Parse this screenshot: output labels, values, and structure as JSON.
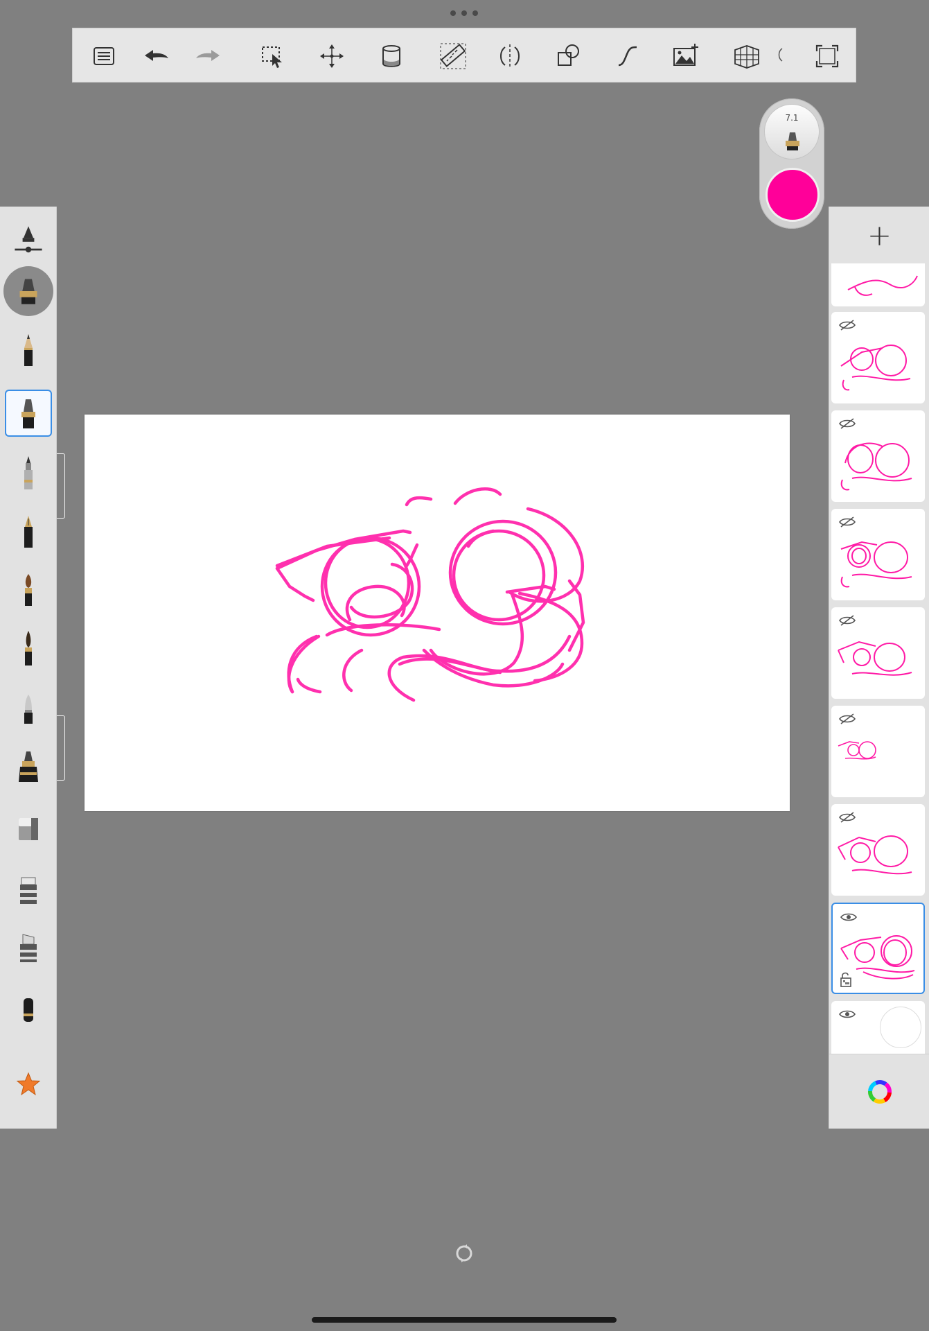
{
  "toolbar": {
    "items": [
      {
        "name": "layers-list-icon"
      },
      {
        "name": "undo-icon"
      },
      {
        "name": "redo-icon"
      },
      {
        "name": "selection-icon"
      },
      {
        "name": "transform-icon"
      },
      {
        "name": "fill-icon"
      },
      {
        "name": "ruler-icon"
      },
      {
        "name": "symmetry-icon"
      },
      {
        "name": "shapes-icon"
      },
      {
        "name": "curve-icon"
      },
      {
        "name": "import-image-icon"
      },
      {
        "name": "perspective-icon"
      },
      {
        "name": "fullscreen-icon"
      }
    ]
  },
  "brush_puck": {
    "size_label": "7.1",
    "color": "#ff0099"
  },
  "brush_library": {
    "tools": [
      "pencil",
      "marker",
      "ballpoint-pen",
      "fountain-pen",
      "paintbrush",
      "ink-brush",
      "airbrush",
      "chisel-marker",
      "eraser",
      "smudge",
      "texture-brush",
      "soft-eraser"
    ],
    "selected": "marker",
    "favorites_icon": "star-icon"
  },
  "layers": {
    "count": 9,
    "active_index": 7,
    "visibility": [
      "hidden",
      "hidden",
      "hidden",
      "hidden",
      "hidden",
      "hidden",
      "hidden",
      "visible",
      "visible"
    ]
  },
  "colors": {
    "stroke": "#ff0099",
    "selection": "#3a8ee6",
    "background": "#808080"
  }
}
